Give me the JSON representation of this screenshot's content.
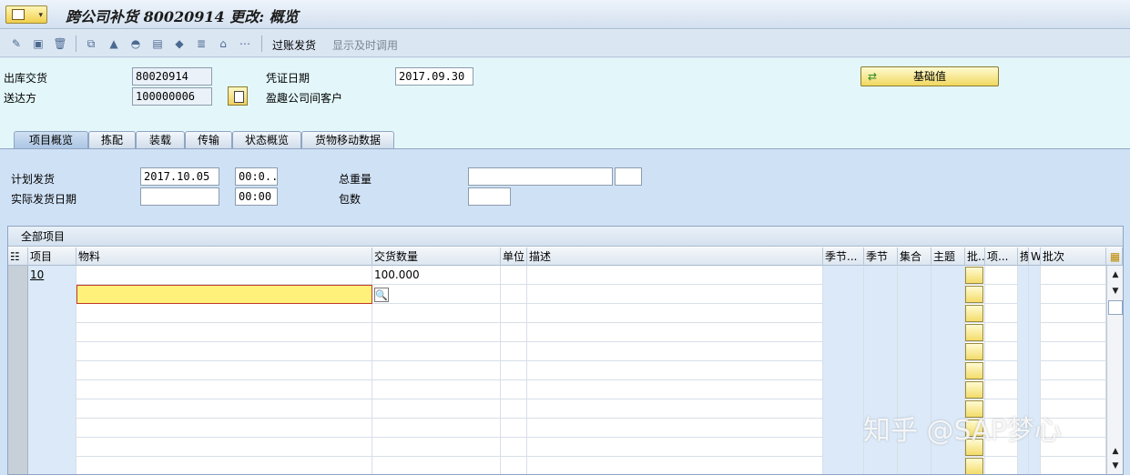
{
  "window": {
    "title": "跨公司补货 80020914 更改: 概览"
  },
  "toolbar": {
    "icons": [
      "glasses-icon",
      "create-icon",
      "delete-icon",
      "copy-icon",
      "warehouse-icon",
      "hat-icon",
      "truck-icon",
      "package-icon",
      "stack-icon",
      "house-icon",
      "network-icon"
    ],
    "post_goods_issue": "过账发货",
    "show_hu": "显示及时调用"
  },
  "header": {
    "delivery_label": "出库交货",
    "delivery_value": "80020914",
    "ship_to_label": "送达方",
    "ship_to_value": "100000006",
    "customer_name": "盈趣公司间客户",
    "doc_date_label": "凭证日期",
    "doc_date_value": "2017.09.30",
    "basis_button": "基础值"
  },
  "tabs": [
    "项目概览",
    "拣配",
    "装载",
    "传输",
    "状态概览",
    "货物移动数据"
  ],
  "tab_content": {
    "planned_gi_label": "计划发货",
    "planned_gi_date": "2017.10.05",
    "planned_gi_time": "00:0...",
    "actual_gi_label": "实际发货日期",
    "actual_gi_date": "",
    "actual_gi_time": "00:00",
    "total_weight_label": "总重量",
    "packages_label": "包数"
  },
  "grid": {
    "title": "全部项目",
    "columns": [
      "项目",
      "物料",
      "交货数量",
      "单位",
      "描述",
      "季节...",
      "季节",
      "集合",
      "主题",
      "批..",
      "项...",
      "拣",
      "W",
      "批次"
    ],
    "rows": [
      {
        "item": "10",
        "material": "",
        "quantity": "100.000",
        "unit": "",
        "description": ""
      }
    ]
  },
  "watermark": "知乎 @SAP梦心"
}
